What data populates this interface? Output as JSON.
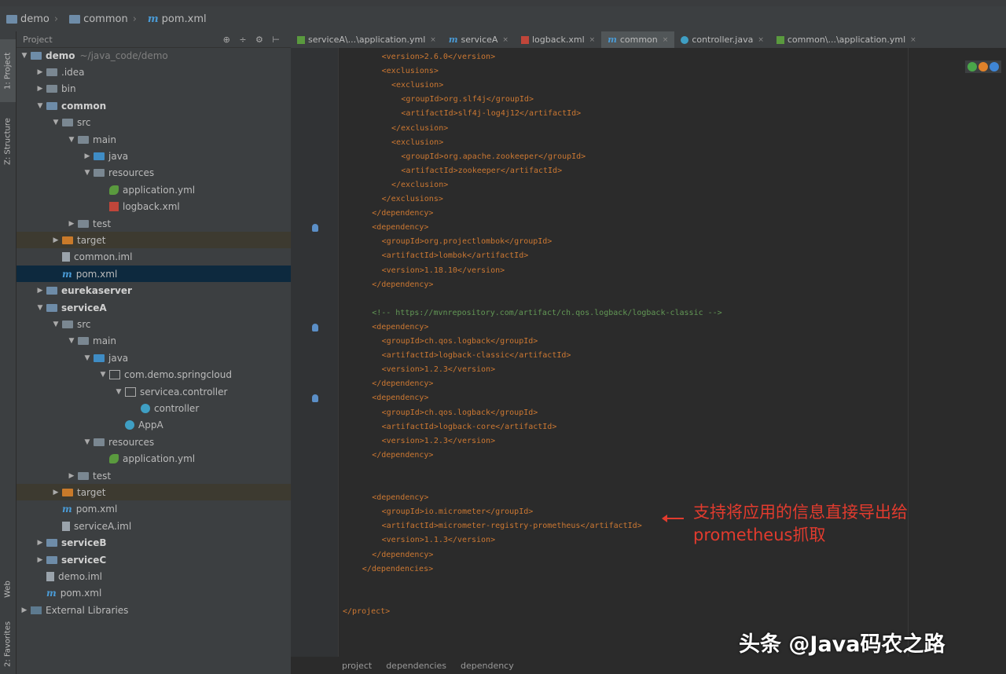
{
  "navbar": {
    "crumbs": [
      "demo",
      "common",
      "pom.xml"
    ]
  },
  "left_strip": {
    "tabs": [
      "1: Project",
      "Z: Structure",
      "Web",
      "2: Favorites"
    ]
  },
  "project_panel": {
    "title": "Project",
    "tools": "⊕ ÷ ⚙ ⊢",
    "tree": [
      {
        "label": "demo",
        "note": "~/java_code/demo",
        "depth": 0,
        "arrow": "▼",
        "icon": "folder-mod",
        "bold": true
      },
      {
        "label": ".idea",
        "depth": 1,
        "arrow": "▶",
        "icon": "folder"
      },
      {
        "label": "bin",
        "depth": 1,
        "arrow": "▶",
        "icon": "folder"
      },
      {
        "label": "common",
        "depth": 1,
        "arrow": "▼",
        "icon": "folder-mod",
        "bold": true
      },
      {
        "label": "src",
        "depth": 2,
        "arrow": "▼",
        "icon": "folder"
      },
      {
        "label": "main",
        "depth": 3,
        "arrow": "▼",
        "icon": "folder"
      },
      {
        "label": "java",
        "depth": 4,
        "arrow": "▶",
        "icon": "folder-blue"
      },
      {
        "label": "resources",
        "depth": 4,
        "arrow": "▼",
        "icon": "folder"
      },
      {
        "label": "application.yml",
        "depth": 5,
        "arrow": "",
        "icon": "yml"
      },
      {
        "label": "logback.xml",
        "depth": 5,
        "arrow": "",
        "icon": "xml"
      },
      {
        "label": "test",
        "depth": 3,
        "arrow": "▶",
        "icon": "folder"
      },
      {
        "label": "target",
        "depth": 2,
        "arrow": "▶",
        "icon": "folder-orange",
        "excluded": true
      },
      {
        "label": "common.iml",
        "depth": 2,
        "arrow": "",
        "icon": "file"
      },
      {
        "label": "pom.xml",
        "depth": 2,
        "arrow": "",
        "icon": "m",
        "selected": true
      },
      {
        "label": "eurekaserver",
        "depth": 1,
        "arrow": "▶",
        "icon": "folder-mod",
        "bold": true
      },
      {
        "label": "serviceA",
        "depth": 1,
        "arrow": "▼",
        "icon": "folder-mod",
        "bold": true
      },
      {
        "label": "src",
        "depth": 2,
        "arrow": "▼",
        "icon": "folder"
      },
      {
        "label": "main",
        "depth": 3,
        "arrow": "▼",
        "icon": "folder"
      },
      {
        "label": "java",
        "depth": 4,
        "arrow": "▼",
        "icon": "folder-blue"
      },
      {
        "label": "com.demo.springcloud",
        "depth": 5,
        "arrow": "▼",
        "icon": "pkg"
      },
      {
        "label": "serviceа.controller",
        "depth": 6,
        "arrow": "▼",
        "icon": "pkg"
      },
      {
        "label": "controller",
        "depth": 7,
        "arrow": "",
        "icon": "cls"
      },
      {
        "label": "AppA",
        "depth": 6,
        "arrow": "",
        "icon": "cls"
      },
      {
        "label": "resources",
        "depth": 4,
        "arrow": "▼",
        "icon": "folder"
      },
      {
        "label": "application.yml",
        "depth": 5,
        "arrow": "",
        "icon": "yml"
      },
      {
        "label": "test",
        "depth": 3,
        "arrow": "▶",
        "icon": "folder"
      },
      {
        "label": "target",
        "depth": 2,
        "arrow": "▶",
        "icon": "folder-orange",
        "excluded": true
      },
      {
        "label": "pom.xml",
        "depth": 2,
        "arrow": "",
        "icon": "m"
      },
      {
        "label": "serviceA.iml",
        "depth": 2,
        "arrow": "",
        "icon": "file"
      },
      {
        "label": "serviceB",
        "depth": 1,
        "arrow": "▶",
        "icon": "folder-mod",
        "bold": true
      },
      {
        "label": "serviceC",
        "depth": 1,
        "arrow": "▶",
        "icon": "folder-mod",
        "bold": true
      },
      {
        "label": "demo.iml",
        "depth": 1,
        "arrow": "",
        "icon": "file"
      },
      {
        "label": "pom.xml",
        "depth": 1,
        "arrow": "",
        "icon": "m"
      },
      {
        "label": "External Libraries",
        "depth": 0,
        "arrow": "▶",
        "icon": "lib"
      }
    ]
  },
  "tabs": [
    {
      "label": "serviceA\\...\\application.yml",
      "icon": "yml"
    },
    {
      "label": "serviceA",
      "icon": "m"
    },
    {
      "label": "logback.xml",
      "icon": "xml"
    },
    {
      "label": "common",
      "icon": "m",
      "active": true
    },
    {
      "label": "controller.java",
      "icon": "cls"
    },
    {
      "label": "common\\...\\application.yml",
      "icon": "yml"
    }
  ],
  "code": [
    {
      "indent": 8,
      "text": "<version>2.6.0</version>",
      "kind": "tag"
    },
    {
      "indent": 8,
      "text": "<exclusions>",
      "kind": "tag"
    },
    {
      "indent": 10,
      "text": "<exclusion>",
      "kind": "tag"
    },
    {
      "indent": 12,
      "text": "<groupId>org.slf4j</groupId>",
      "kind": "tag"
    },
    {
      "indent": 12,
      "text": "<artifactId>slf4j-log4j12</artifactId>",
      "kind": "tag"
    },
    {
      "indent": 10,
      "text": "</exclusion>",
      "kind": "tag"
    },
    {
      "indent": 10,
      "text": "<exclusion>",
      "kind": "tag"
    },
    {
      "indent": 12,
      "text": "<groupId>org.apache.zookeeper</groupId>",
      "kind": "tag"
    },
    {
      "indent": 12,
      "text": "<artifactId>zookeeper</artifactId>",
      "kind": "tag"
    },
    {
      "indent": 10,
      "text": "</exclusion>",
      "kind": "tag"
    },
    {
      "indent": 8,
      "text": "</exclusions>",
      "kind": "tag"
    },
    {
      "indent": 6,
      "text": "</dependency>",
      "kind": "tag"
    },
    {
      "indent": 6,
      "text": "<dependency>",
      "kind": "tag",
      "gutter": true
    },
    {
      "indent": 8,
      "text": "<groupId>org.projectlombok</groupId>",
      "kind": "tag"
    },
    {
      "indent": 8,
      "text": "<artifactId>lombok</artifactId>",
      "kind": "tag"
    },
    {
      "indent": 8,
      "text": "<version>1.18.10</version>",
      "kind": "tag"
    },
    {
      "indent": 6,
      "text": "</dependency>",
      "kind": "tag"
    },
    {
      "indent": 0,
      "text": "",
      "kind": "tag"
    },
    {
      "indent": 6,
      "text": "<!-- https://mvnrepository.com/artifact/ch.qos.logback/logback-classic -->",
      "kind": "cmt"
    },
    {
      "indent": 6,
      "text": "<dependency>",
      "kind": "tag",
      "gutter": true
    },
    {
      "indent": 8,
      "text": "<groupId>ch.qos.logback</groupId>",
      "kind": "tag"
    },
    {
      "indent": 8,
      "text": "<artifactId>logback-classic</artifactId>",
      "kind": "tag"
    },
    {
      "indent": 8,
      "text": "<version>1.2.3</version>",
      "kind": "tag"
    },
    {
      "indent": 6,
      "text": "</dependency>",
      "kind": "tag"
    },
    {
      "indent": 6,
      "text": "<dependency>",
      "kind": "tag",
      "gutter": true
    },
    {
      "indent": 8,
      "text": "<groupId>ch.qos.logback</groupId>",
      "kind": "tag"
    },
    {
      "indent": 8,
      "text": "<artifactId>logback-core</artifactId>",
      "kind": "tag"
    },
    {
      "indent": 8,
      "text": "<version>1.2.3</version>",
      "kind": "tag"
    },
    {
      "indent": 6,
      "text": "</dependency>",
      "kind": "tag"
    },
    {
      "indent": 0,
      "text": "",
      "kind": "tag"
    },
    {
      "indent": 0,
      "text": "",
      "kind": "tag"
    },
    {
      "indent": 6,
      "text": "<dependency>",
      "kind": "tag"
    },
    {
      "indent": 8,
      "text": "<groupId>io.micrometer</groupId>",
      "kind": "tag"
    },
    {
      "indent": 8,
      "text": "<artifactId>micrometer-registry-prometheus</artifactId>",
      "kind": "tag"
    },
    {
      "indent": 8,
      "text": "<version>1.1.3</version>",
      "kind": "tag"
    },
    {
      "indent": 6,
      "text": "</dependency>",
      "kind": "tag"
    },
    {
      "indent": 4,
      "text": "</dependencies>",
      "kind": "tag"
    },
    {
      "indent": 0,
      "text": "",
      "kind": "tag"
    },
    {
      "indent": 0,
      "text": "",
      "kind": "tag"
    },
    {
      "indent": 0,
      "text": "</project>",
      "kind": "tag"
    }
  ],
  "annotation": {
    "line1": "支持将应用的信息直接导出给",
    "line2": "prometheus抓取",
    "color": "#e23b2e"
  },
  "editor_breadcrumbs": [
    "project",
    "dependencies",
    "dependency"
  ],
  "watermark": "头条 @Java码农之路",
  "colors": {
    "tag": "#cc7832",
    "comment": "#629755",
    "selection": "#0d293e",
    "panel_bg": "#3c3f41",
    "editor_bg": "#2b2b2b"
  }
}
